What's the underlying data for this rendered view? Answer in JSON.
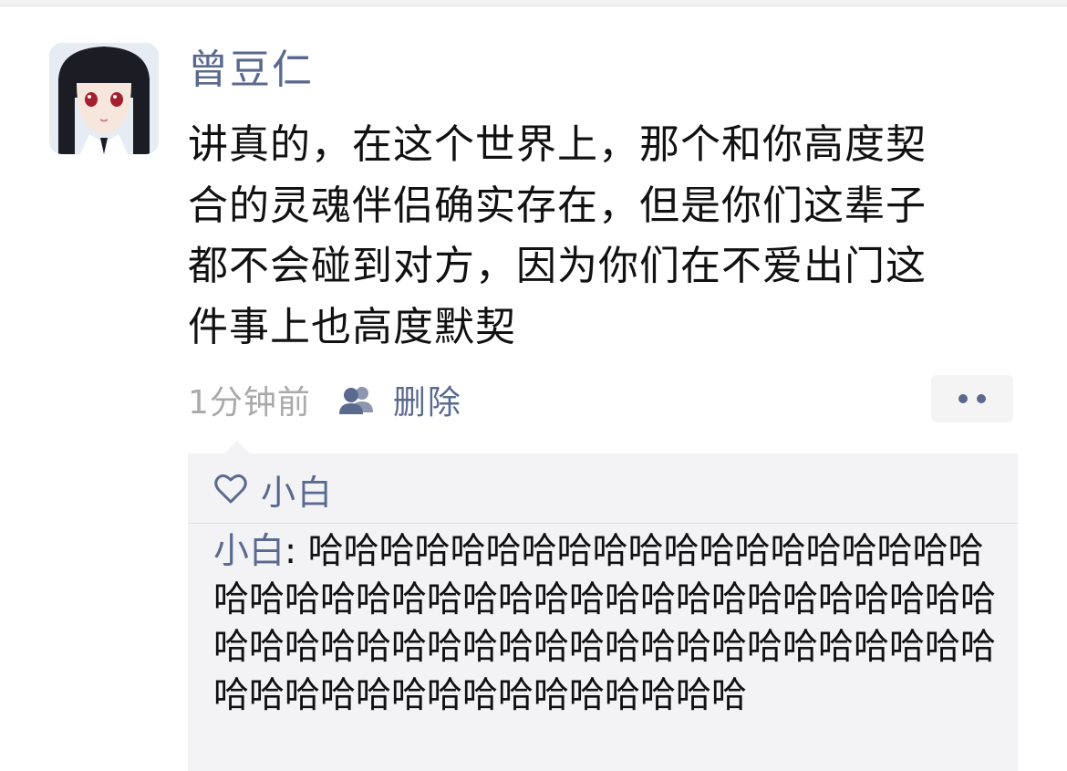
{
  "post": {
    "username": "曾豆仁",
    "text": "讲真的，在这个世界上，那个和你高度契\n合的灵魂伴侣确实存在，但是你们这辈子\n都不会碰到对方，因为你们在不爱出门这\n件事上也高度默契",
    "timestamp": "1分钟前",
    "privacy_icon": "people-icon",
    "delete_label": "删除",
    "more_icon": "more-dots-icon"
  },
  "likes": {
    "icon": "heart-icon",
    "names": "小白"
  },
  "comment": {
    "author": "小白",
    "separator": ": ",
    "text": "哈哈哈哈哈哈哈哈哈哈哈哈哈哈哈哈哈哈哈哈哈哈哈哈哈哈哈哈哈哈哈哈哈哈哈哈哈哈哈哈哈哈哈哈哈哈哈哈哈哈哈哈哈哈哈哈哈哈哈哈哈哈哈哈哈哈哈哈哈哈哈哈哈哈哈哈哈哈"
  },
  "colors": {
    "link": "#5a6a8e",
    "text": "#111111",
    "muted": "#aaaaaa",
    "comment_bg": "#f3f3f5"
  }
}
